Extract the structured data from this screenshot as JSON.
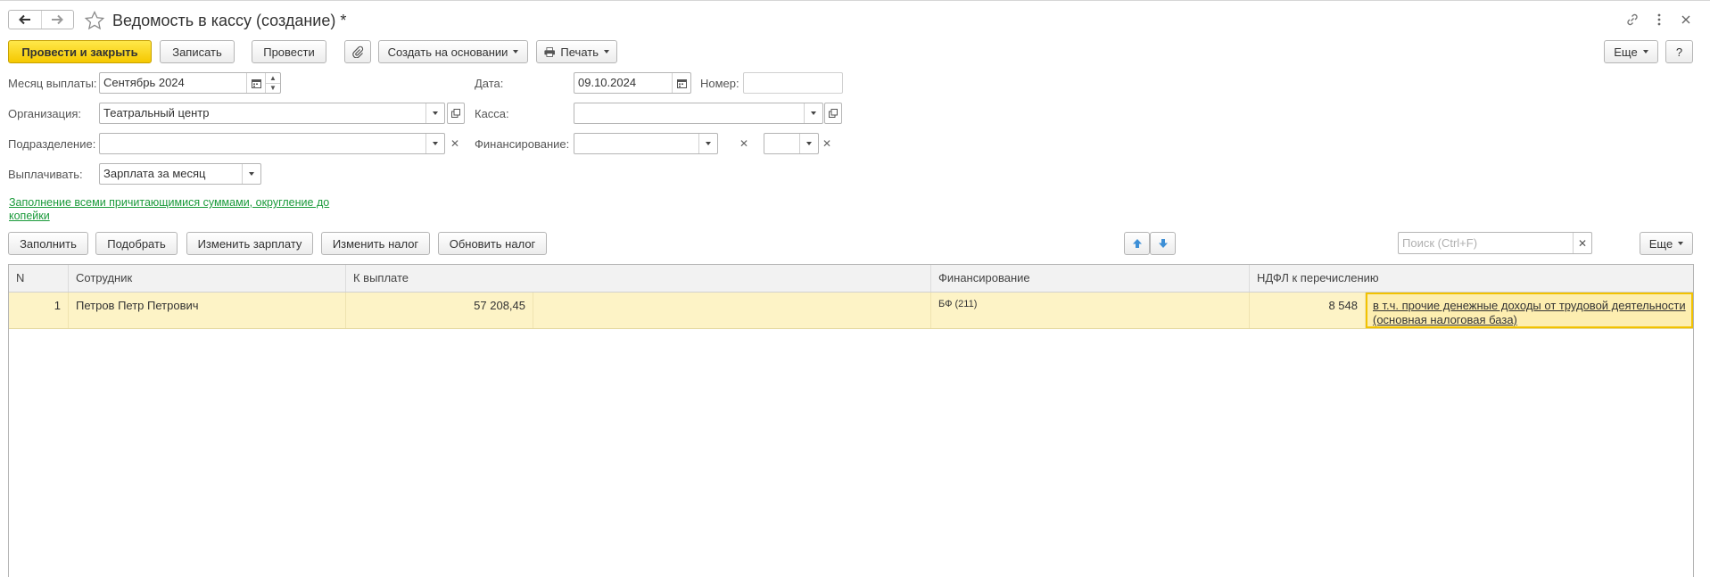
{
  "window": {
    "title": "Ведомость в кассу (создание) *"
  },
  "toolbar": {
    "post_close": "Провести и закрыть",
    "save": "Записать",
    "post": "Провести",
    "create_based": "Создать на основании",
    "print": "Печать",
    "more": "Еще",
    "help": "?"
  },
  "form": {
    "month_label": "Месяц выплаты:",
    "month_value": "Сентябрь 2024",
    "date_label": "Дата:",
    "date_value": "09.10.2024",
    "number_label": "Номер:",
    "number_value": "",
    "org_label": "Организация:",
    "org_value": "Театральный центр",
    "cash_label": "Касса:",
    "cash_value": "",
    "dept_label": "Подразделение:",
    "dept_value": "",
    "fin_label": "Финансирование:",
    "fin_value": "",
    "fin_value2": "",
    "pay_label": "Выплачивать:",
    "pay_value": "Зарплата за месяц",
    "fill_note": "Заполнение всеми причитающимися суммами, округление до копейки"
  },
  "table_toolbar": {
    "fill": "Заполнить",
    "pick": "Подобрать",
    "change_salary": "Изменить зарплату",
    "change_tax": "Изменить налог",
    "update_tax": "Обновить налог",
    "search_placeholder": "Поиск (Ctrl+F)",
    "more": "Еще"
  },
  "table": {
    "columns": [
      "N",
      "Сотрудник",
      "К выплате",
      "Финансирование",
      "НДФЛ к перечислению"
    ],
    "rows": [
      {
        "n": "1",
        "employee": "Петров Петр Петрович",
        "amount": "57 208,45",
        "financing": "БФ (211)",
        "ndfl": "8 548",
        "ndfl_detail": "в т.ч. прочие денежные доходы от трудовой деятельности (основная налоговая база)"
      }
    ]
  },
  "colors": {
    "primary": "#f5c800",
    "selected_row": "#fdf3c6",
    "link_green": "#1a9a3a",
    "arrow_blue": "#3d8fd6"
  },
  "icons": {
    "back": "arrow-left-icon",
    "forward": "arrow-right-icon",
    "favorite": "star-icon",
    "link": "link-icon",
    "menu": "kebab-icon",
    "close": "close-icon",
    "attach": "paperclip-icon",
    "print": "printer-icon",
    "calendar": "calendar-icon",
    "up": "arrow-up-icon",
    "down": "arrow-down-icon"
  }
}
